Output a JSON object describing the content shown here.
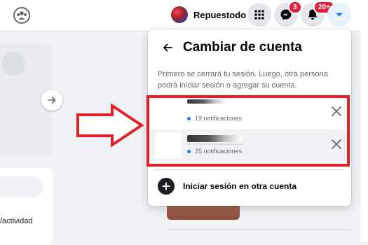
{
  "topbar": {
    "profile_name": "Repuestodo",
    "messenger_badge": "3",
    "notifications_badge": "20+"
  },
  "left": {
    "activity_text": "/actividad"
  },
  "dropdown": {
    "title": "Cambiar de cuenta",
    "description": "Primero se cerrará tu sesión. Luego, otra persona podrá iniciar sesión o agregar su cuenta.",
    "accounts": [
      {
        "notifications": "19 notificaciones"
      },
      {
        "notifications": "25 notificaciones"
      }
    ],
    "add_account_label": "Iniciar sesión en otra cuenta"
  },
  "colors": {
    "accent": "#1877f2",
    "badge": "#e41e3f",
    "highlight": "#e32028"
  }
}
